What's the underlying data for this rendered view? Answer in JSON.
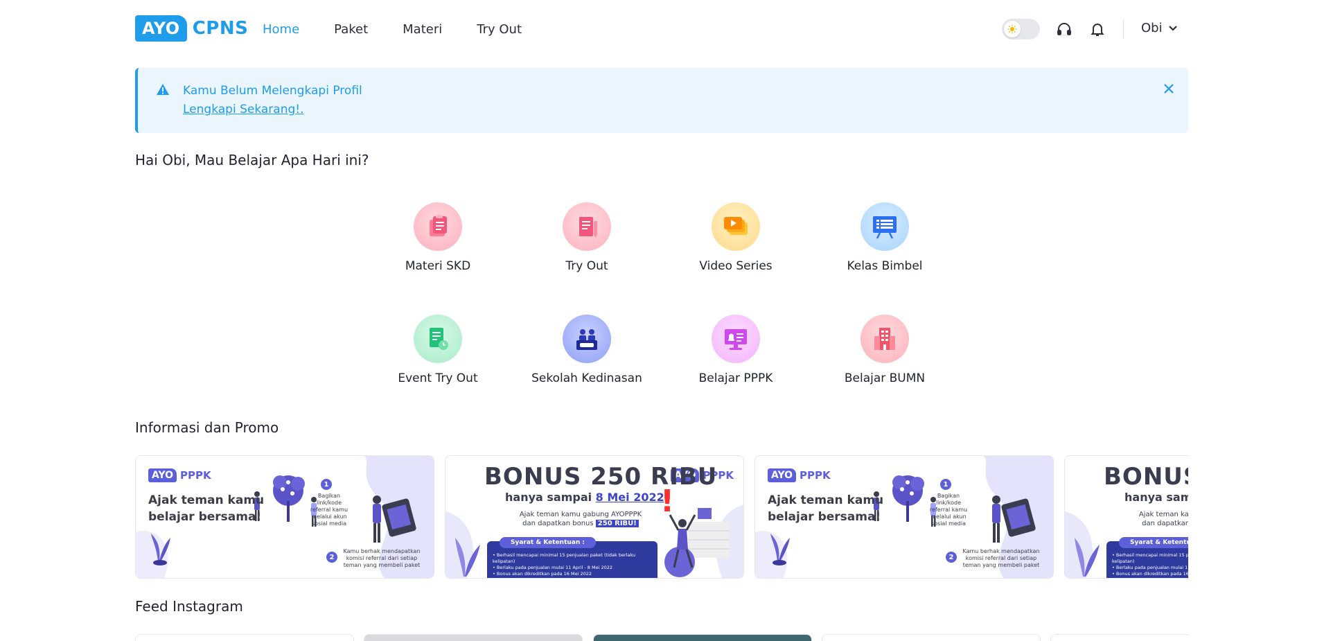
{
  "brand": {
    "box": "AYO",
    "text": "CPNS",
    "color": "#1f9cea"
  },
  "nav": [
    {
      "label": "Home",
      "active": true
    },
    {
      "label": "Paket",
      "active": false
    },
    {
      "label": "Materi",
      "active": false
    },
    {
      "label": "Try Out",
      "active": false
    }
  ],
  "header": {
    "user_name": "Obi",
    "theme_toggle": "light"
  },
  "alert": {
    "message": "Kamu Belum Melengkapi Profil",
    "link": "Lengkapi Sekarang!."
  },
  "greeting": "Hai Obi, Mau Belajar Apa Hari ini?",
  "menu": [
    {
      "label": "Materi SKD",
      "icon": "clipboard-icon"
    },
    {
      "label": "Try Out",
      "icon": "document-pencil-icon"
    },
    {
      "label": "Video Series",
      "icon": "video-stack-icon"
    },
    {
      "label": "Kelas Bimbel",
      "icon": "whiteboard-icon"
    },
    {
      "label": "Event Try Out",
      "icon": "document-clock-icon"
    },
    {
      "label": "Sekolah Kedinasan",
      "icon": "school-podium-icon"
    },
    {
      "label": "Belajar PPPK",
      "icon": "monitor-bell-icon"
    },
    {
      "label": "Belajar BUMN",
      "icon": "building-icon"
    }
  ],
  "promo_section": {
    "title": "Informasi dan Promo"
  },
  "promo_brand": {
    "box": "AYO",
    "text": "PPPK"
  },
  "promo_referral": {
    "headline": "Ajak teman kamu belajar bersama!",
    "step1": "Bagikan link/kode referral kamu melalui akun sosial media",
    "step2": "Kamu berhak mendapatkan komisi referral dari setiap teman yang membeli paket"
  },
  "promo_bonus": {
    "title": "BONUS 250 RIBU",
    "subtitle_prefix": "hanya sampai ",
    "subtitle_date": "8 Mei 2022",
    "desc_line1": "Ajak teman kamu gabung AYOPPPK",
    "desc_line2": "dan dapatkan bonus",
    "desc_amount": "250 RIBU!",
    "terms_title": "Syarat & Ketentuan :",
    "terms": [
      "• Berhasil mencapai minimal 15 penjualan paket (tidak berlaku kelipatan)",
      "• Berlaku pada penjualan mulai 11 April - 8 Mei 2022",
      "• Bonus akan dikreditkan pada 16 Mei 2022"
    ]
  },
  "feed_section": {
    "title": "Feed Instagram"
  }
}
